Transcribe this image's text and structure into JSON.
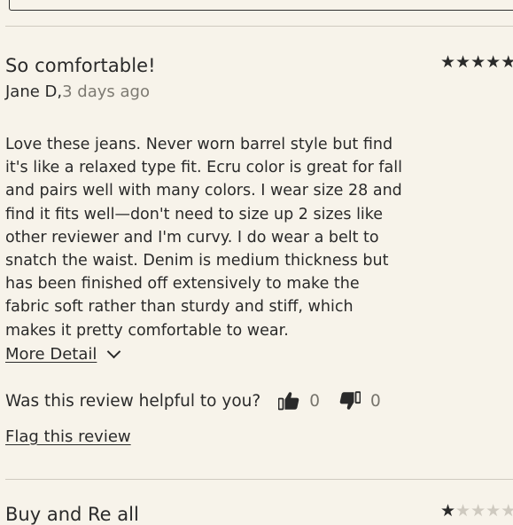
{
  "review": {
    "title": "So comfortable!",
    "rating": 5,
    "rating_max": 5,
    "reviewer_name": "Jane D,",
    "posted_ago": "3 days ago",
    "body": "Love these jeans. Never worn barrel style but find it's like a relaxed type fit. Ecru color is great for fall and pairs well with many colors. I wear size 28 and find it fits well—don't need to size up 2 sizes like other reviewer and I'm curvy. I do wear a belt to snatch the waist. Denim is medium thickness but has been finished off extensively to make the fabric soft rather than sturdy and stiff, which makes it pretty comfortable to wear.",
    "more_detail_label": "More Detail",
    "helpful_question": "Was this review helpful to you?",
    "helpful_yes_count": "0",
    "helpful_no_count": "0",
    "flag_label": "Flag this review"
  },
  "next_review": {
    "title": "Buy and Re all",
    "rating": 1,
    "rating_max": 5
  },
  "icons": {
    "rating_star": "star-icon",
    "thumbs_up": "thumbs-up-icon",
    "thumbs_down": "thumbs-down-icon",
    "expand": "chevron-down-icon"
  },
  "colors": {
    "background": "#f7f3ea",
    "text": "#2a2a2a",
    "muted": "#7d7a72",
    "divider": "#cfcac0"
  }
}
